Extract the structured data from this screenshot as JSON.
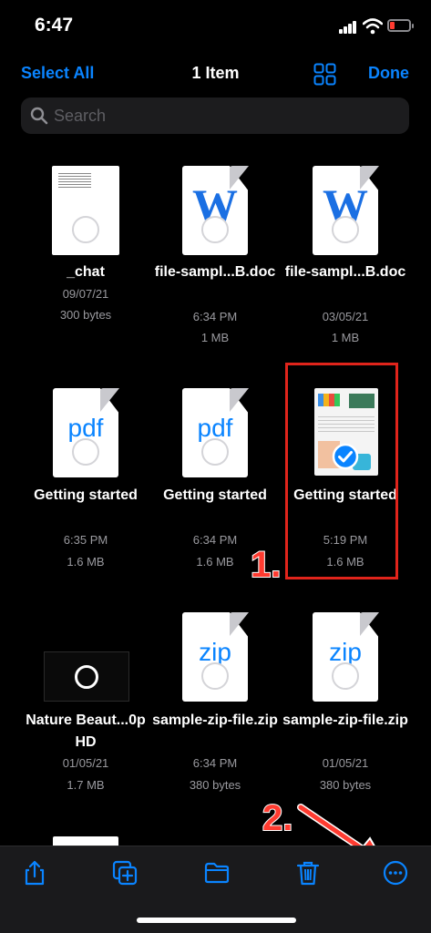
{
  "status_bar": {
    "time": "6:47"
  },
  "nav": {
    "select_all": "Select All",
    "title": "1 Item",
    "done": "Done"
  },
  "search": {
    "placeholder": "Search"
  },
  "files": [
    {
      "name": "_chat",
      "date": "09/07/21",
      "size": "300 bytes",
      "kind": "text"
    },
    {
      "name": "file-sampl...B.doc",
      "date": "6:34 PM",
      "size": "1 MB",
      "kind": "word"
    },
    {
      "name": "file-sampl...B.doc",
      "date": "03/05/21",
      "size": "1 MB",
      "kind": "word"
    },
    {
      "name": "Getting started",
      "date": "6:35 PM",
      "size": "1.6 MB",
      "kind": "pdf",
      "label": "pdf"
    },
    {
      "name": "Getting started",
      "date": "6:34 PM",
      "size": "1.6 MB",
      "kind": "pdf",
      "label": "pdf"
    },
    {
      "name": "Getting started",
      "date": "5:19 PM",
      "size": "1.6 MB",
      "kind": "pdf-preview",
      "selected": true
    },
    {
      "name": "Nature Beaut...0p HD",
      "date": "01/05/21",
      "size": "1.7 MB",
      "kind": "video"
    },
    {
      "name": "sample-zip-file.zip",
      "date": "6:34 PM",
      "size": "380 bytes",
      "kind": "zip",
      "label": "zip"
    },
    {
      "name": "sample-zip-file.zip",
      "date": "01/05/21",
      "size": "380 bytes",
      "kind": "zip",
      "label": "zip"
    }
  ],
  "annotations": {
    "step1": "1.",
    "step2": "2."
  },
  "toolbar": {
    "items": [
      "share-icon",
      "duplicate-icon",
      "folder-icon",
      "trash-icon",
      "more-icon"
    ]
  },
  "colors": {
    "accent": "#0a84ff",
    "annotation": "#ff3b30"
  }
}
